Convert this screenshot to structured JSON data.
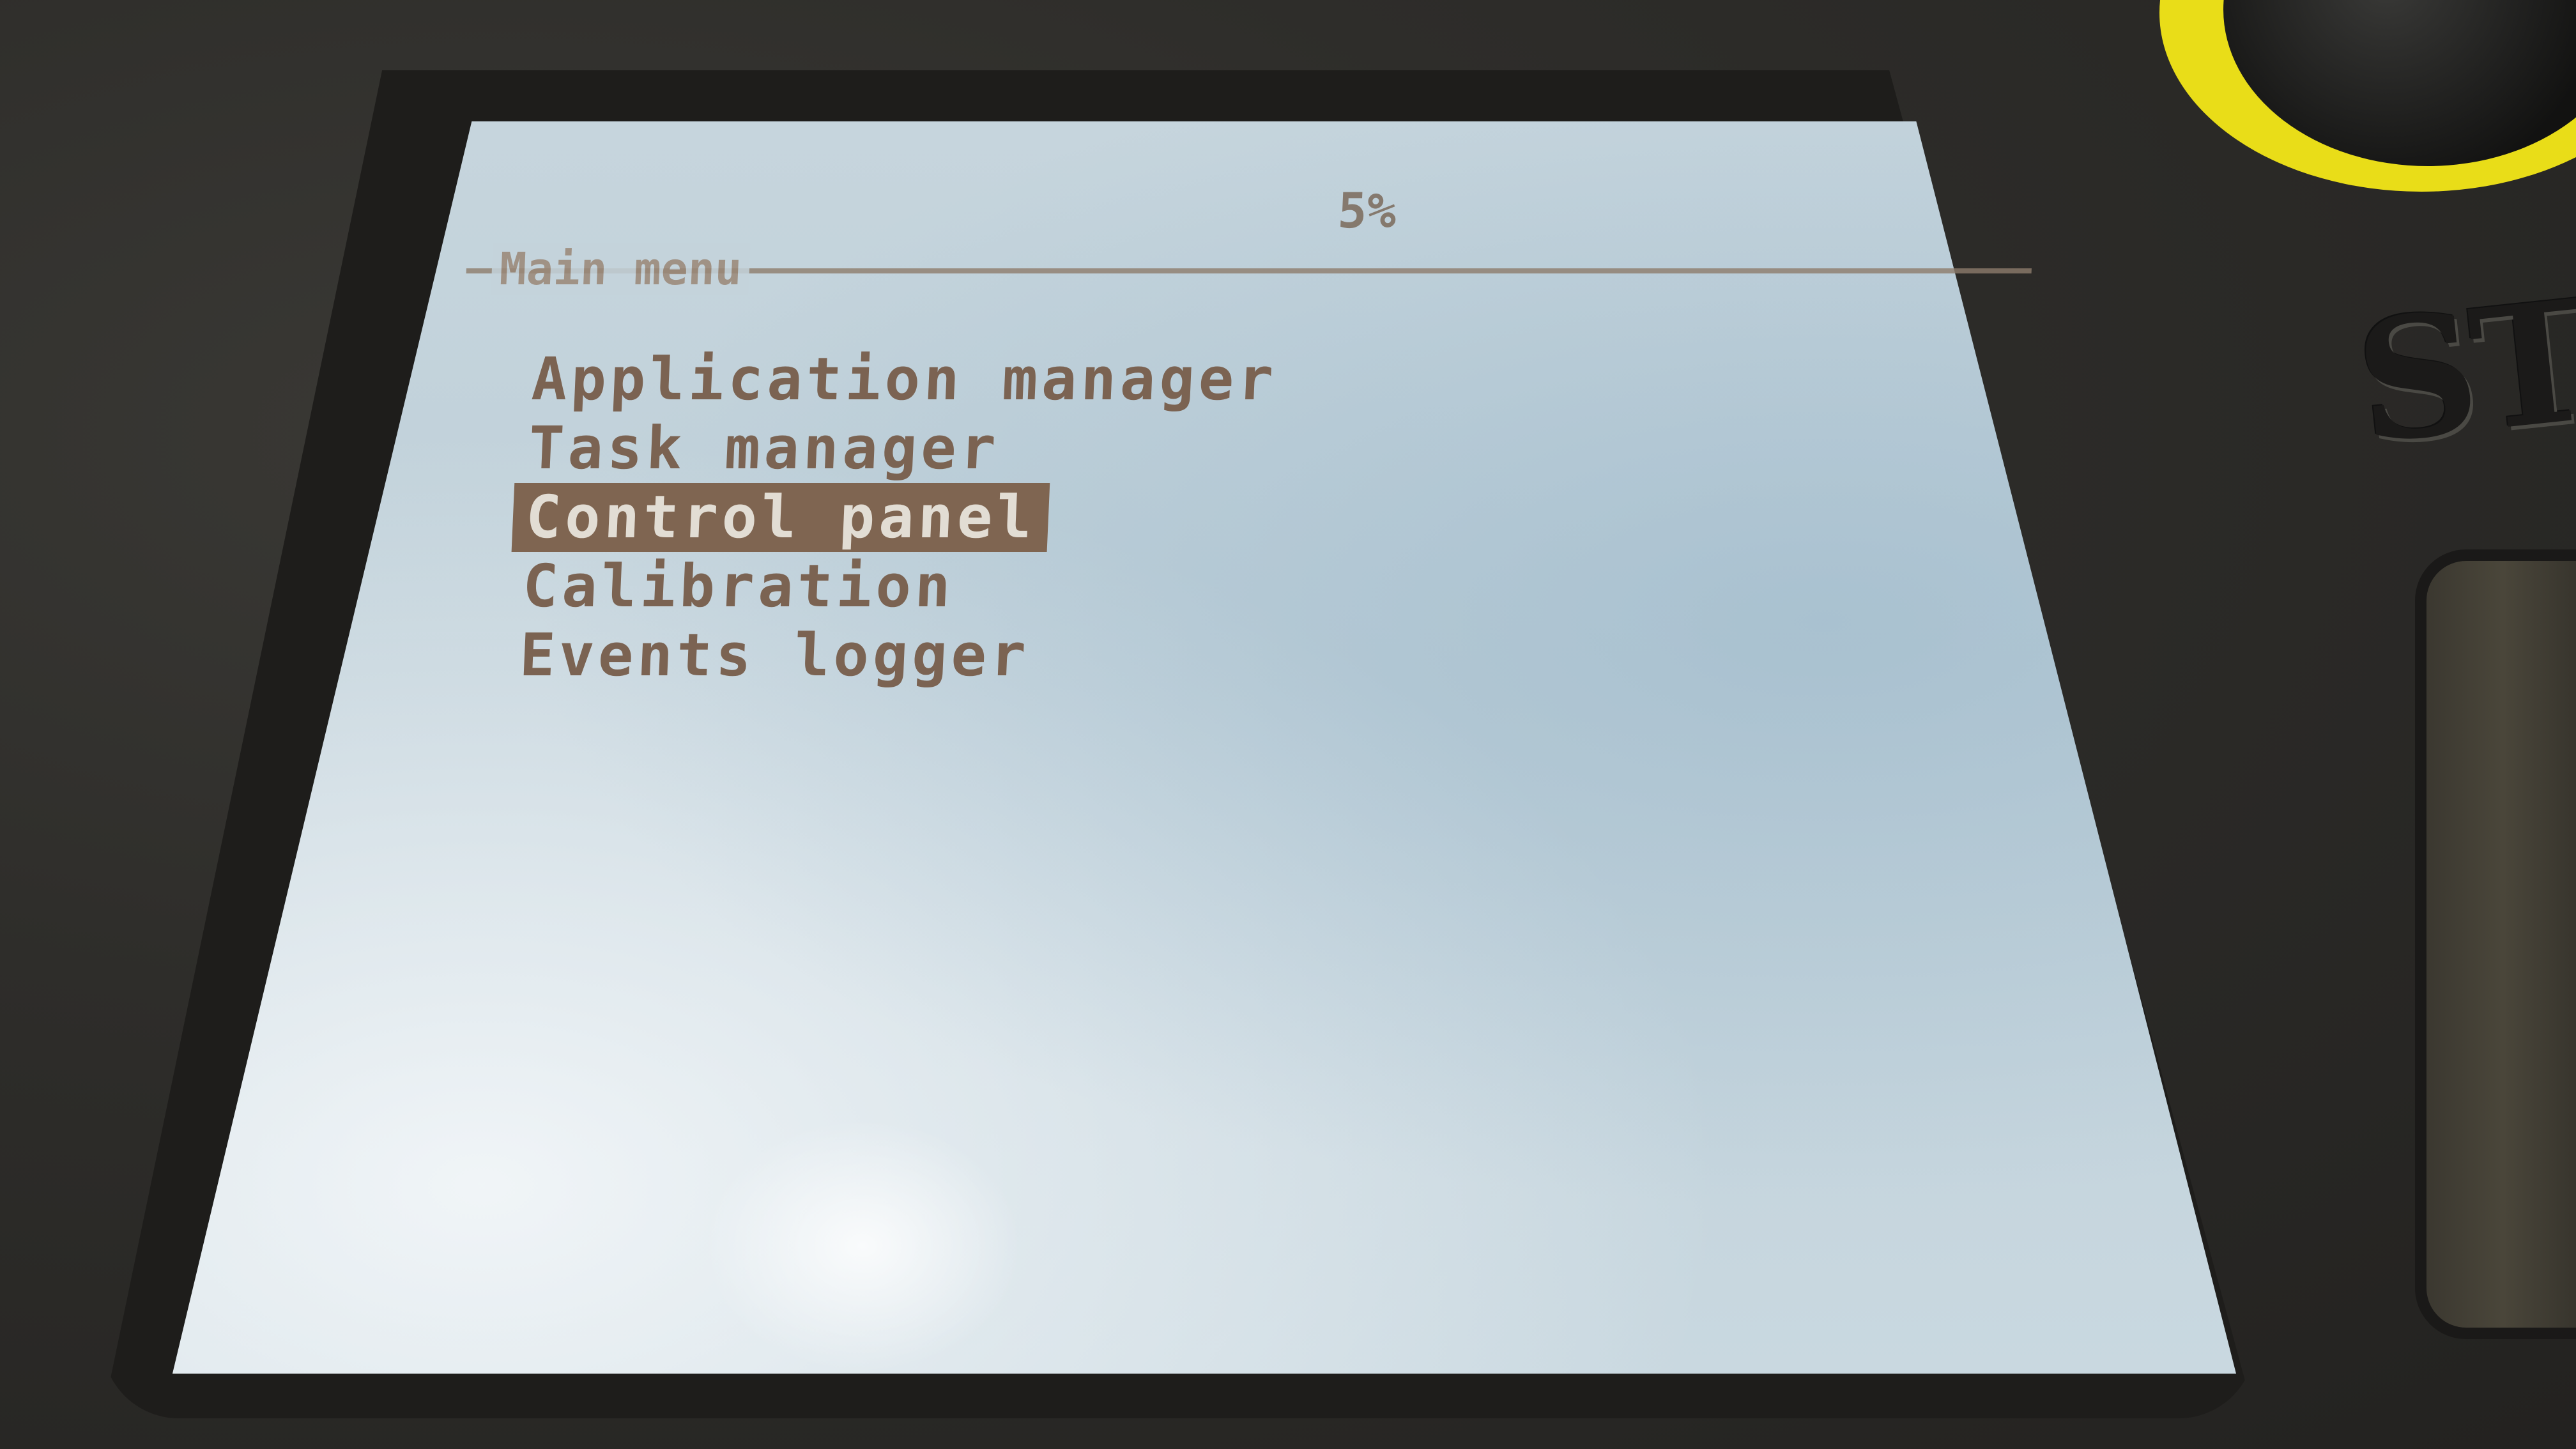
{
  "device": {
    "brand_partial": "ST"
  },
  "screen": {
    "status_value": "5%",
    "menu": {
      "title": "Main menu",
      "items": [
        {
          "label": "Application manager",
          "selected": false
        },
        {
          "label": "Task manager",
          "selected": false
        },
        {
          "label": "Control panel",
          "selected": true
        },
        {
          "label": "Calibration",
          "selected": false
        },
        {
          "label": "Events logger",
          "selected": false
        }
      ]
    }
  },
  "colors": {
    "lcd_background": "#c4d3db",
    "lcd_text": "#7b6352",
    "selection_highlight": "#7f6551",
    "knob_ring": "#e9dd18"
  }
}
